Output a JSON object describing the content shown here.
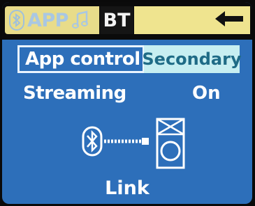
{
  "tabs": {
    "app_label": "APP",
    "bt_label": "BT",
    "app_icons": [
      "bluetooth-icon",
      "music-note-icon"
    ],
    "back_icon": "left-arrow-icon"
  },
  "settings": [
    {
      "label": "App control",
      "value": "Secondary"
    },
    {
      "label": "Streaming",
      "value": "On"
    }
  ],
  "link": {
    "icons": [
      "bluetooth-icon",
      "speaker-icon"
    ],
    "status": "Link"
  },
  "colors": {
    "screen_background": "#2d6fba",
    "active_tab": "#efe48f",
    "selected_value": "#c7eef1"
  }
}
